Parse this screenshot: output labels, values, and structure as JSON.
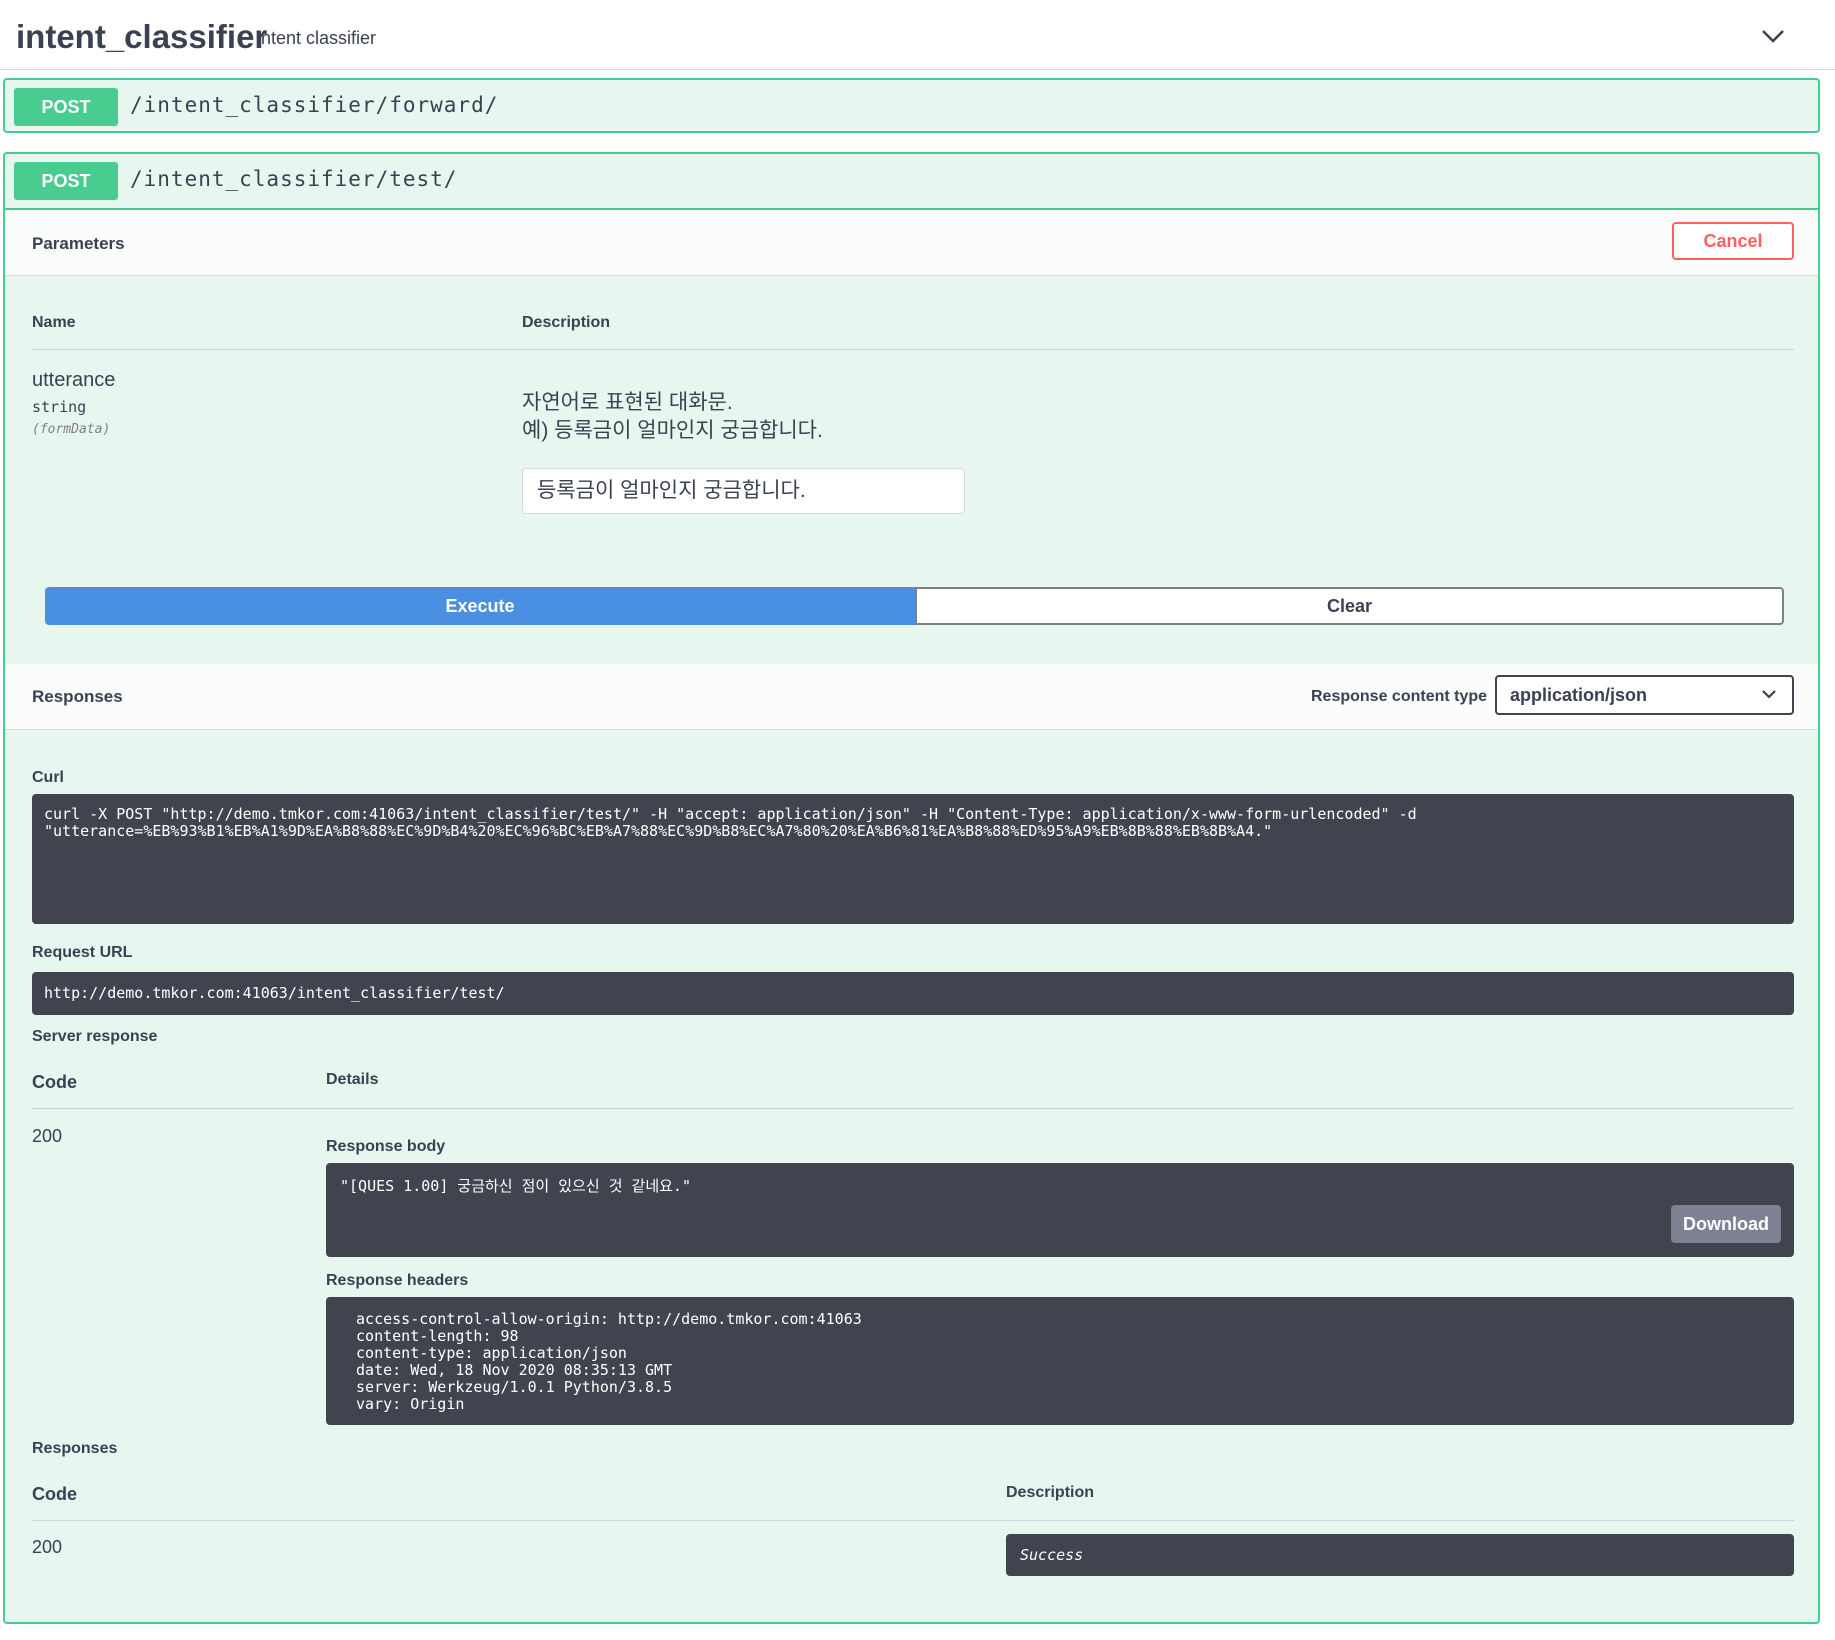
{
  "tag": {
    "name": "intent_classifier",
    "description": "intent classifier"
  },
  "operations": {
    "forward": {
      "method": "POST",
      "path": "/intent_classifier/forward/"
    },
    "test": {
      "method": "POST",
      "path": "/intent_classifier/test/"
    }
  },
  "parameters": {
    "title": "Parameters",
    "cancel_label": "Cancel",
    "col_name": "Name",
    "col_description": "Description",
    "items": [
      {
        "name": "utterance",
        "type": "string",
        "in": "(formData)",
        "description_line1": "자연어로 표현된 대화문.",
        "description_line2": "예) 등록금이 얼마인지 궁금합니다.",
        "value": "등록금이 얼마인지 궁금합니다."
      }
    ]
  },
  "actions": {
    "execute_label": "Execute",
    "clear_label": "Clear"
  },
  "responses_section": {
    "title": "Responses",
    "content_type_label": "Response content type",
    "content_type_value": "application/json"
  },
  "curl": {
    "label": "Curl",
    "command": "curl -X POST \"http://demo.tmkor.com:41063/intent_classifier/test/\" -H \"accept: application/json\" -H \"Content-Type: application/x-www-form-urlencoded\" -d\n\"utterance=%EB%93%B1%EB%A1%9D%EA%B8%88%EC%9D%B4%20%EC%96%BC%EB%A7%88%EC%9D%B8%EC%A7%80%20%EA%B6%81%EA%B8%88%ED%95%A9%EB%8B%88%EB%8B%A4.\""
  },
  "request_url": {
    "label": "Request URL",
    "value": "http://demo.tmkor.com:41063/intent_classifier/test/"
  },
  "server_response": {
    "label": "Server response",
    "col_code": "Code",
    "col_details": "Details",
    "code": "200",
    "body_label": "Response body",
    "body": "\"[QUES 1.00] 궁금하신 점이 있으신 것 같네요.\"",
    "download_label": "Download",
    "headers_label": "Response headers",
    "headers": " access-control-allow-origin: http://demo.tmkor.com:41063\n content-length: 98\n content-type: application/json\n date: Wed, 18 Nov 2020 08:35:13 GMT\n server: Werkzeug/1.0.1 Python/3.8.5\n vary: Origin"
  },
  "documented_responses": {
    "label": "Responses",
    "col_code": "Code",
    "col_description": "Description",
    "code": "200",
    "description": "Success"
  },
  "colors": {
    "post": "#49cc90",
    "post_bg": "#e8f6f0",
    "execute": "#4990e2",
    "cancel": "#ff6060",
    "code_bg": "#41444e"
  },
  "icons": {
    "tag_toggle": "chevron-down-icon",
    "select": "chevron-down-icon"
  }
}
